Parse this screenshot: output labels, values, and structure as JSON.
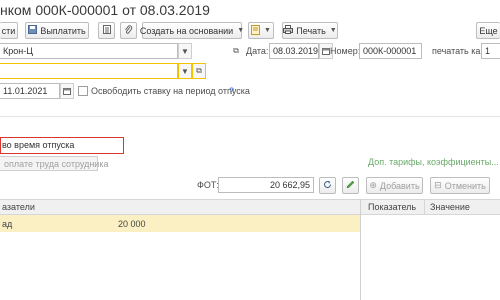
{
  "window": {
    "title": "нком 000К-000001 от 08.03.2019"
  },
  "toolbar": {
    "btn_partial": "сти",
    "pay_label": "Выплатить",
    "create_based_label": "Создать на основании",
    "print_label": "Печать",
    "more_label": "Еще"
  },
  "form": {
    "employee_value": "Крон-Ц",
    "date_label": "Дата:",
    "date_value": "08.03.2019",
    "number_label": "Номер:",
    "number_value": "000К-000001",
    "print_as_label": "печатать как:",
    "print_as_value": "1",
    "second_value": "",
    "from_date_value": "11.01.2021",
    "release_rate_label": "Освободить ставку на период отпуска",
    "help_mark": "?"
  },
  "section": {
    "vacation_label": "во время отпуска",
    "pay_button": "оплате труда сотрудника",
    "tariffs_link": "Доп. тарифы, коэффициенты..."
  },
  "fot": {
    "label": "ФОТ:",
    "value": "20 662,95",
    "add_label": "Добавить",
    "cancel_label": "Отменить"
  },
  "table": {
    "col_indicators": "азатели",
    "rows": [
      {
        "name": "ад",
        "value": "20 000"
      }
    ]
  },
  "right_table": {
    "col_indicator": "Показатель",
    "col_value": "Значение"
  },
  "colors": {
    "highlight_row": "#fbf0c3",
    "red_frame": "#d9372e",
    "link_green": "#6aa96a",
    "field_yellow": "#f4c200"
  }
}
